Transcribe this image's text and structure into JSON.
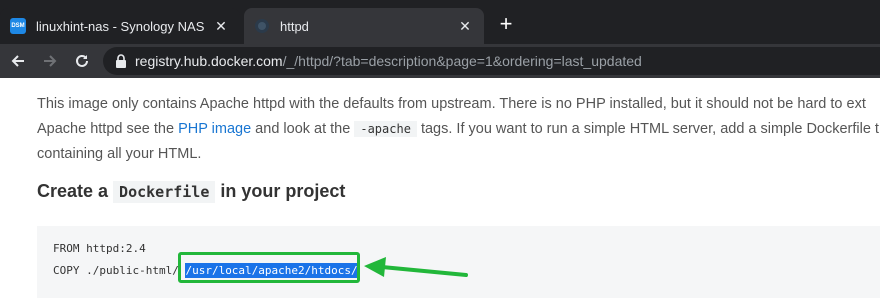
{
  "tabs": [
    {
      "title": "linuxhint-nas - Synology NAS",
      "favicon": "synology-dsm-icon",
      "favicon_color": "#1e88e5",
      "active": false
    },
    {
      "title": "httpd",
      "favicon": "docker-icon",
      "active": true
    }
  ],
  "new_tab_label": "+",
  "address": {
    "host": "registry.hub.docker.com",
    "path": "/_/httpd/?tab=description&page=1&ordering=last_updated"
  },
  "content": {
    "para_line1": "This image only contains Apache httpd with the defaults from upstream. There is no PHP installed, but it should not be hard to ext",
    "para_line2_a": "Apache httpd see the ",
    "para_line2_link": "PHP image",
    "para_line2_b": " and look at the ",
    "para_line2_code": "-apache",
    "para_line2_c": " tags. If you want to run a simple HTML server, add a simple Dockerfile t",
    "para_line3": "containing all your HTML.",
    "heading_a": "Create a ",
    "heading_code": "Dockerfile",
    "heading_b": " in your project",
    "code_line1": "FROM httpd:2.4",
    "code_line2_prefix": "COPY ./public-html/ ",
    "code_line2_selected": "/usr/local/apache2/htdocs/"
  },
  "colors": {
    "highlight_green": "#22b73a",
    "link_blue": "#1976d2",
    "selection_blue": "#1a73e8"
  }
}
